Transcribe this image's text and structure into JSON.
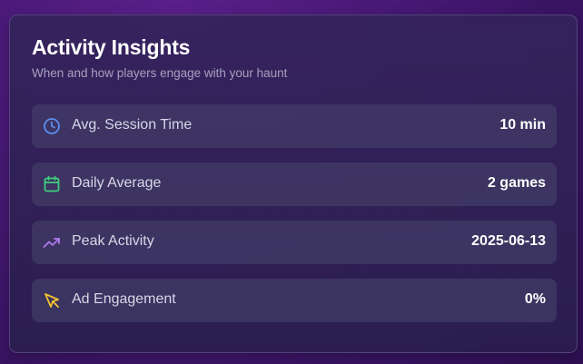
{
  "card": {
    "title": "Activity Insights",
    "subtitle": "When and how players engage with your haunt"
  },
  "rows": [
    {
      "label": "Avg. Session Time",
      "value": "10 min",
      "icon": "clock-icon",
      "icon_color": "#5b8def"
    },
    {
      "label": "Daily Average",
      "value": "2 games",
      "icon": "calendar-icon",
      "icon_color": "#3ecf7a"
    },
    {
      "label": "Peak Activity",
      "value": "2025-06-13",
      "icon": "trending-up-icon",
      "icon_color": "#b07cf0"
    },
    {
      "label": "Ad Engagement",
      "value": "0%",
      "icon": "cursor-pointer-icon",
      "icon_color": "#f2c230"
    }
  ]
}
